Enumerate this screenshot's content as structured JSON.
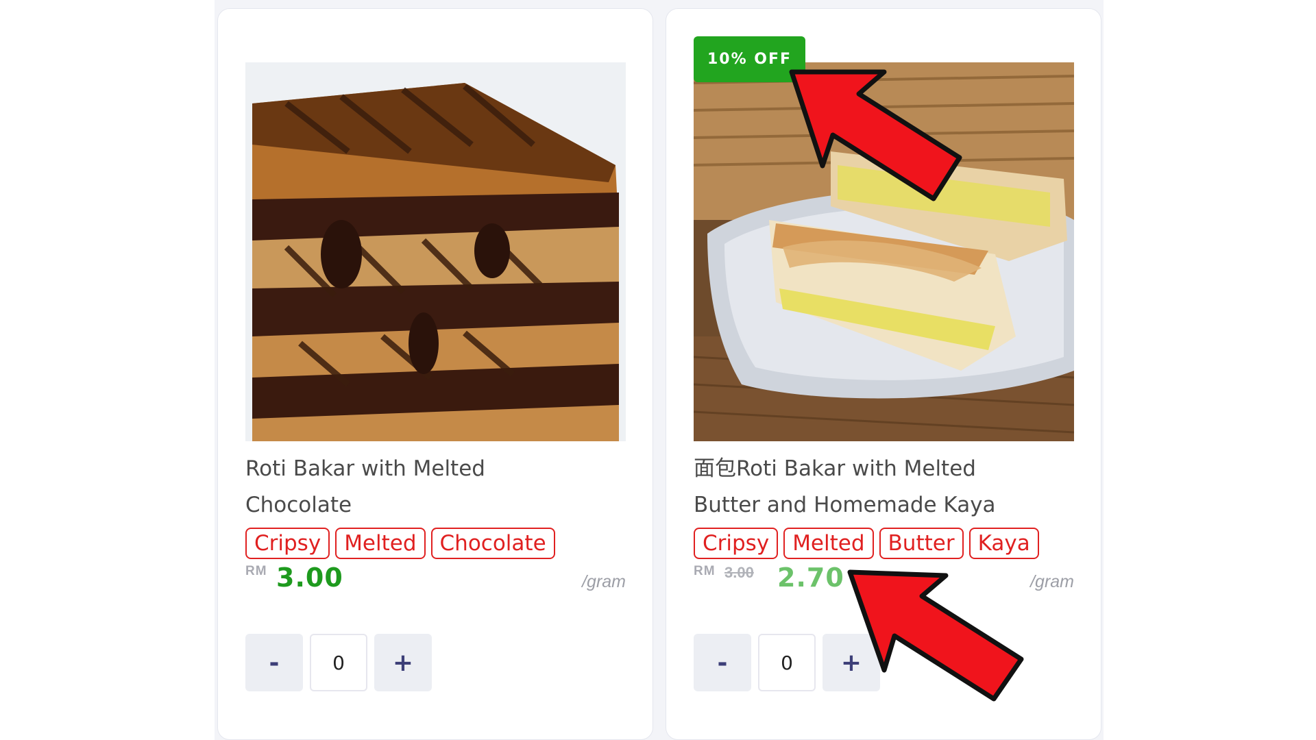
{
  "products": [
    {
      "image_alt": "Grilled chocolate sandwich",
      "title_line1": "Roti Bakar with Melted",
      "title_line2": "Chocolate",
      "tags": [
        "Cripsy",
        "Melted",
        "Chocolate"
      ],
      "currency": "RM",
      "price": "3.00",
      "unit": "/gram",
      "qty_minus": "-",
      "qty_value": "0",
      "qty_plus": "+"
    },
    {
      "image_alt": "Kaya butter toast",
      "badge": "10% OFF",
      "title_line1": "面包Roti Bakar with Melted",
      "title_line2": "Butter and Homemade Kaya",
      "tags": [
        "Cripsy",
        "Melted",
        "Butter",
        "Kaya"
      ],
      "currency": "RM",
      "old_price": "3.00",
      "price": "2.70",
      "unit": "/gram",
      "qty_minus": "-",
      "qty_value": "0",
      "qty_plus": "+"
    }
  ],
  "colors": {
    "accent_green": "#22a51f",
    "price_green": "#1e9a1e",
    "sale_green": "#6cc26a",
    "tag_red": "#e02020",
    "arrow_red": "#f0141c"
  }
}
